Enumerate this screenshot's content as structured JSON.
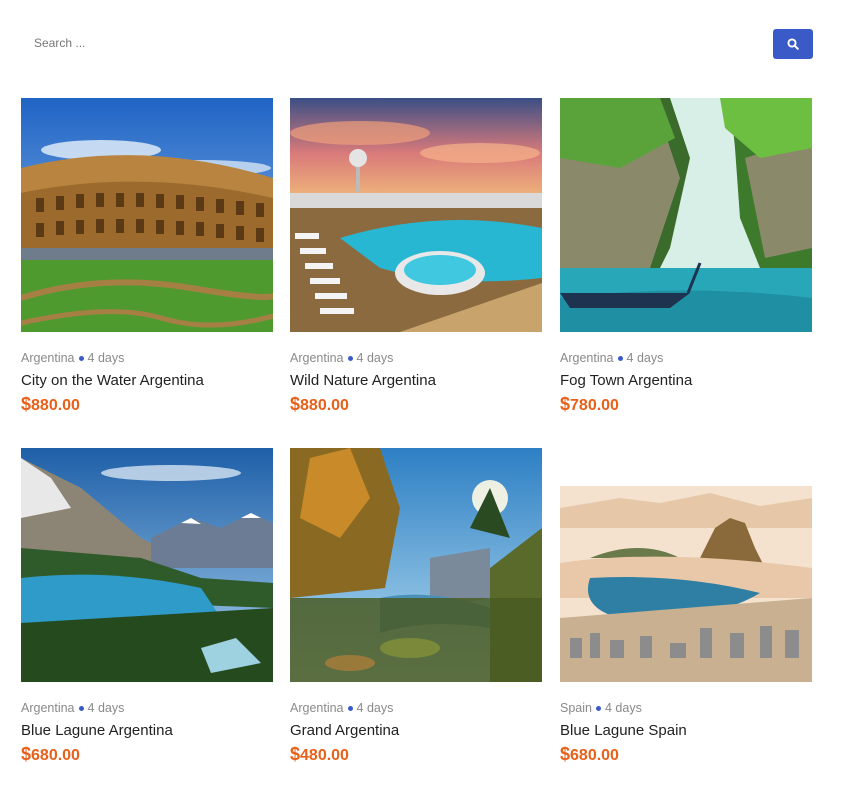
{
  "search": {
    "placeholder": "Search ...",
    "button_icon": "search-icon"
  },
  "colors": {
    "accent": "#3a5bc7",
    "price": "#e8611a",
    "meta": "#8a8a8a"
  },
  "tours": [
    {
      "country": "Argentina",
      "duration": "4 days",
      "title": "City on the Water Argentina",
      "currency": "$",
      "price": "880.00",
      "image": "colosseum"
    },
    {
      "country": "Argentina",
      "duration": "4 days",
      "title": "Wild Nature Argentina",
      "currency": "$",
      "price": "880.00",
      "image": "cruise-ship-pool"
    },
    {
      "country": "Argentina",
      "duration": "4 days",
      "title": "Fog Town Argentina",
      "currency": "$",
      "price": "780.00",
      "image": "limestone-cliffs-boat"
    },
    {
      "country": "Argentina",
      "duration": "4 days",
      "title": "Blue Lagune Argentina",
      "currency": "$",
      "price": "680.00",
      "image": "mountain-lake"
    },
    {
      "country": "Argentina",
      "duration": "4 days",
      "title": "Grand Argentina",
      "currency": "$",
      "price": "480.00",
      "image": "forest-river"
    },
    {
      "country": "Spain",
      "duration": "4 days",
      "title": "Blue Lagune Spain",
      "currency": "$",
      "price": "680.00",
      "image": "rio-bay"
    }
  ]
}
